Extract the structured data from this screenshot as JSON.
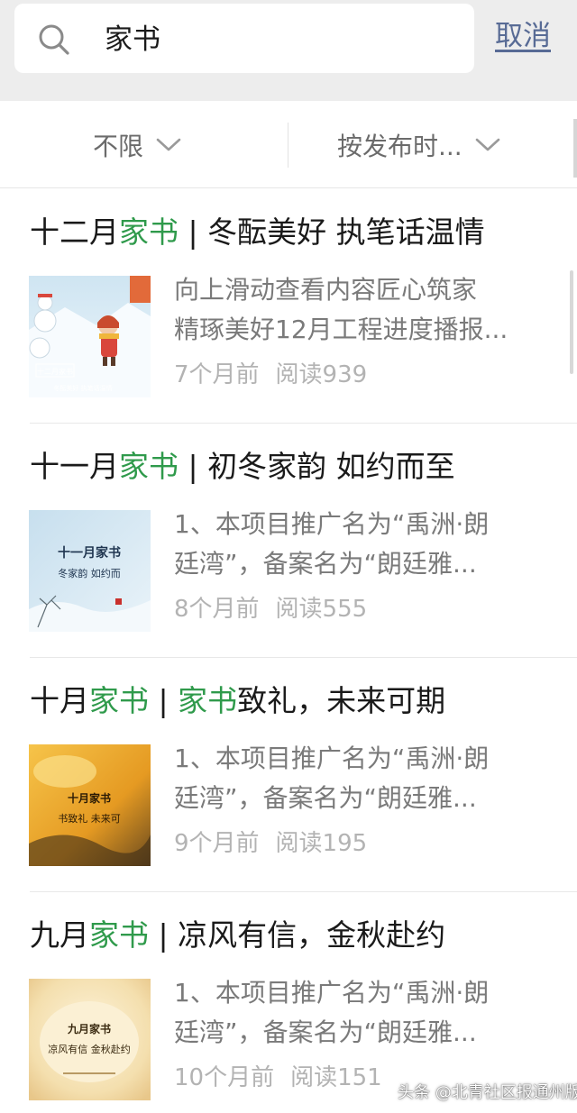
{
  "search": {
    "query": "家书",
    "cancel_label": "取消"
  },
  "filters": [
    {
      "label": "不限"
    },
    {
      "label": "按发布时..."
    }
  ],
  "results": [
    {
      "title_parts": [
        {
          "text": "十二月",
          "hl": false
        },
        {
          "text": "家书",
          "hl": true
        },
        {
          "text": " | 冬酝美好 执笔话温情",
          "hl": false
        }
      ],
      "snippet_lines": [
        "向上滑动查看内容匠心筑家",
        "精琢美好12月工程进度播报..."
      ],
      "time": "7个月前",
      "reads": "阅读939",
      "thumb": {
        "line1": "十二月家书",
        "line2": "冬酝美好 执笔话温情"
      }
    },
    {
      "title_parts": [
        {
          "text": "十一月",
          "hl": false
        },
        {
          "text": "家书",
          "hl": true
        },
        {
          "text": " | 初冬家韵 如约而至",
          "hl": false
        }
      ],
      "snippet_lines": [
        "1、本项目推广名为“禹洲·朗",
        "廷湾”，备案名为“朗廷雅..."
      ],
      "time": "8个月前",
      "reads": "阅读555",
      "thumb": {
        "line1": "十一月家书",
        "line2": "冬家韵 如约而"
      }
    },
    {
      "title_parts": [
        {
          "text": "十月",
          "hl": false
        },
        {
          "text": "家书",
          "hl": true
        },
        {
          "text": " | ",
          "hl": false
        },
        {
          "text": "家书",
          "hl": true
        },
        {
          "text": "致礼，未来可期",
          "hl": false
        }
      ],
      "snippet_lines": [
        "1、本项目推广名为“禹洲·朗",
        "廷湾”，备案名为“朗廷雅..."
      ],
      "time": "9个月前",
      "reads": "阅读195",
      "thumb": {
        "line1": "十月家书",
        "line2": "书致礼 未来可"
      }
    },
    {
      "title_parts": [
        {
          "text": "九月",
          "hl": false
        },
        {
          "text": "家书",
          "hl": true
        },
        {
          "text": " | 凉风有信，金秋赴约",
          "hl": false
        }
      ],
      "snippet_lines": [
        "1、本项目推广名为“禹洲·朗",
        "廷湾”，备案名为“朗廷雅..."
      ],
      "time": "10个月前",
      "reads": "阅读151",
      "thumb": {
        "line1": "九月家书",
        "line2": "凉风有信 金秋赴约"
      }
    }
  ],
  "watermark": "头条 @北青社区报通州版",
  "colors": {
    "highlight": "#2f9a4b",
    "cancel_link": "#586b95",
    "header_bg": "#ededed"
  },
  "icons": {
    "search": "search-icon",
    "filter_chevron": "chevron-down-icon"
  }
}
